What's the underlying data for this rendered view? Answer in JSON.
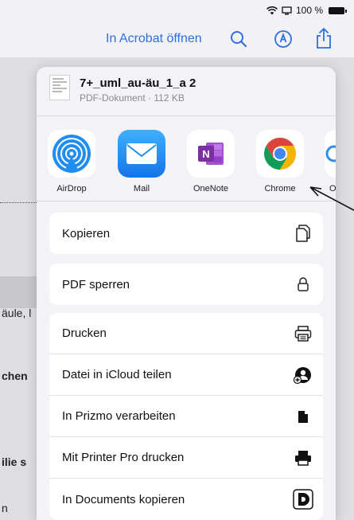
{
  "status_bar": {
    "battery_text": "100 %"
  },
  "nav": {
    "open_in_acrobat": "In Acrobat öffnen"
  },
  "background_document": {
    "text_1": "äule, l",
    "text_2": "chen",
    "text_3": "ilie s",
    "text_4": "n"
  },
  "share_sheet": {
    "file": {
      "name": "7+_uml_au-äu_1_a 2",
      "meta": "PDF-Dokument · 112 KB"
    },
    "apps": [
      {
        "label": "AirDrop",
        "icon": "airdrop-icon"
      },
      {
        "label": "Mail",
        "icon": "mail-icon"
      },
      {
        "label": "OneNote",
        "icon": "onenote-icon"
      },
      {
        "label": "Chrome",
        "icon": "chrome-icon"
      },
      {
        "label": "Or",
        "icon": "app-icon"
      }
    ],
    "group_1": [
      {
        "label": "Kopieren",
        "icon": "copy-icon"
      }
    ],
    "group_2": [
      {
        "label": "PDF sperren",
        "icon": "lock-icon"
      }
    ],
    "group_3": [
      {
        "label": "Drucken",
        "icon": "printer-icon"
      },
      {
        "label": "Datei in iCloud teilen",
        "icon": "icloud-share-icon"
      },
      {
        "label": "In Prizmo verarbeiten",
        "icon": "document-icon"
      },
      {
        "label": "Mit Printer Pro drucken",
        "icon": "printer-pro-icon"
      },
      {
        "label": "In Documents kopieren",
        "icon": "documents-app-icon"
      }
    ]
  },
  "colors": {
    "accent_blue": "#2f6fe0",
    "mail_blue": "#1e8ff5",
    "onenote_purple": "#7b2fa3",
    "airdrop_blue": "#1f8ef0"
  }
}
